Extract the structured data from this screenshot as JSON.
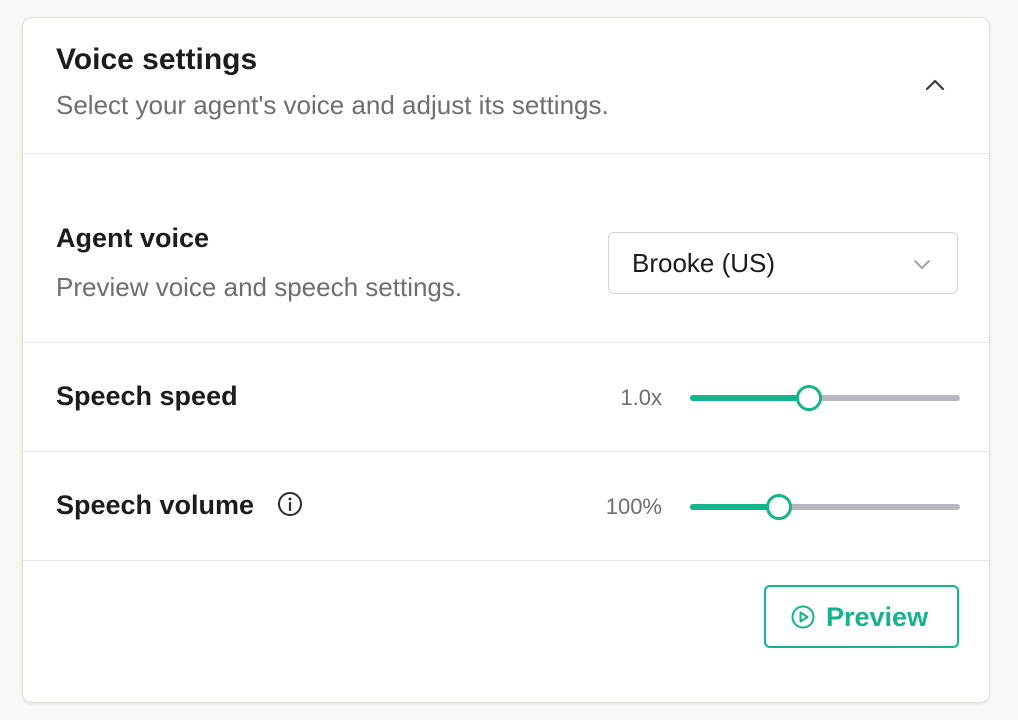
{
  "header": {
    "title": "Voice settings",
    "subtitle": "Select your agent's voice and adjust its settings.",
    "collapse_icon": "chevron-up-icon"
  },
  "agent_voice": {
    "label": "Agent voice",
    "hint": "Preview voice and speech settings.",
    "selected": "Brooke (US)",
    "dropdown_icon": "chevron-down-icon"
  },
  "speech_speed": {
    "label": "Speech speed",
    "value_text": "1.0x",
    "fill_fraction": 0.44
  },
  "speech_volume": {
    "label": "Speech volume",
    "value_text": "100%",
    "fill_fraction": 0.33,
    "info_icon": "info-icon"
  },
  "preview": {
    "label": "Preview",
    "icon": "play-circle-icon"
  },
  "colors": {
    "accent": "#14b48c",
    "track": "#b7b7bb",
    "muted_text": "#6e6e73",
    "background": "#f9f8f5"
  }
}
